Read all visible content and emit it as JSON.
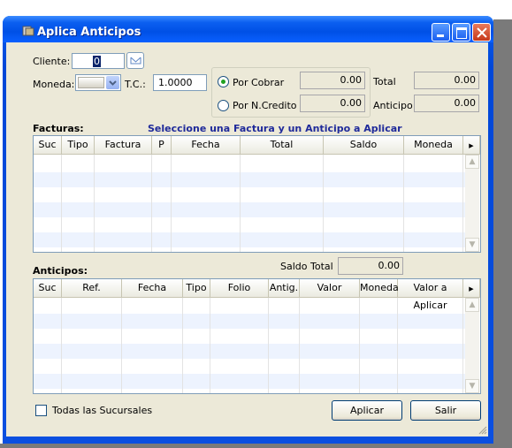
{
  "window": {
    "title": "Aplica Anticipos"
  },
  "form": {
    "cliente_label": "Cliente:",
    "cliente_value": "0",
    "moneda_label": "Moneda:",
    "moneda_value": "",
    "tc_label": "T.C.:",
    "tc_value": "1.0000",
    "por_cobrar_label": "Por Cobrar",
    "por_cobrar_value": "0.00",
    "por_ncredito_label": "Por N.Credito",
    "por_ncredito_value": "0.00",
    "total_label": "Total",
    "total_value": "0.00",
    "anticipo_label": "Anticipo",
    "anticipo_value": "0.00"
  },
  "facturas": {
    "label": "Facturas:",
    "hint": "Seleccione una Factura y un Anticipo a Aplicar",
    "columns": [
      "Suc",
      "Tipo",
      "Factura",
      "P",
      "Fecha",
      "Total",
      "Saldo",
      "Moneda"
    ]
  },
  "anticipos": {
    "label": "Anticipos:",
    "saldo_total_label": "Saldo Total",
    "saldo_total_value": "0.00",
    "columns": [
      "Suc",
      "Ref.",
      "Fecha",
      "Tipo",
      "Folio",
      "Antig.",
      "Valor",
      "Moneda",
      "Valor a Aplicar"
    ]
  },
  "footer": {
    "todas_sucursales_label": "Todas las Sucursales",
    "aplicar_label": "Aplicar",
    "salir_label": "Salir"
  },
  "colors": {
    "title_bar": "#0050e6",
    "face": "#ece9d8",
    "hint_text": "#1f2a9a",
    "radio_selected": "#21a121"
  }
}
